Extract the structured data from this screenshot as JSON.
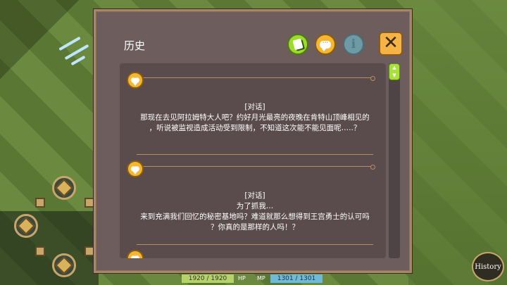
{
  "panel": {
    "title": "历史",
    "close_symbol": "✕",
    "info_symbol": "i",
    "icons": {
      "auto": "book-icon",
      "chat": "speech-bubble-icon",
      "info": "info-icon",
      "close": "close-icon"
    }
  },
  "entries": [
    {
      "tag": "[对话]",
      "lines": [
        "那现在去见阿拉姆特大人吧？约好月光最亮的夜晚在肯特山顶峰相见的",
        "，听说被监视造成活动受到限制，不知道这次能不能见面呢…..？"
      ]
    },
    {
      "tag": "[对话]",
      "lines": [
        "为了抓我…",
        "来到充满我们回忆的秘密基地吗？难道就那么想得到王宫勇士的认可吗",
        "？你真的是那样的人吗！？"
      ]
    }
  ],
  "status": {
    "hp_value": "1920 / 1920",
    "hp_label": "HP",
    "mp_label": "MP",
    "mp_value": "1301 / 1301"
  },
  "history_button": "History",
  "colors": {
    "panel_bg": "#6d5e5d",
    "accent_orange": "#f5b730",
    "accent_green": "#9bdc2a"
  }
}
